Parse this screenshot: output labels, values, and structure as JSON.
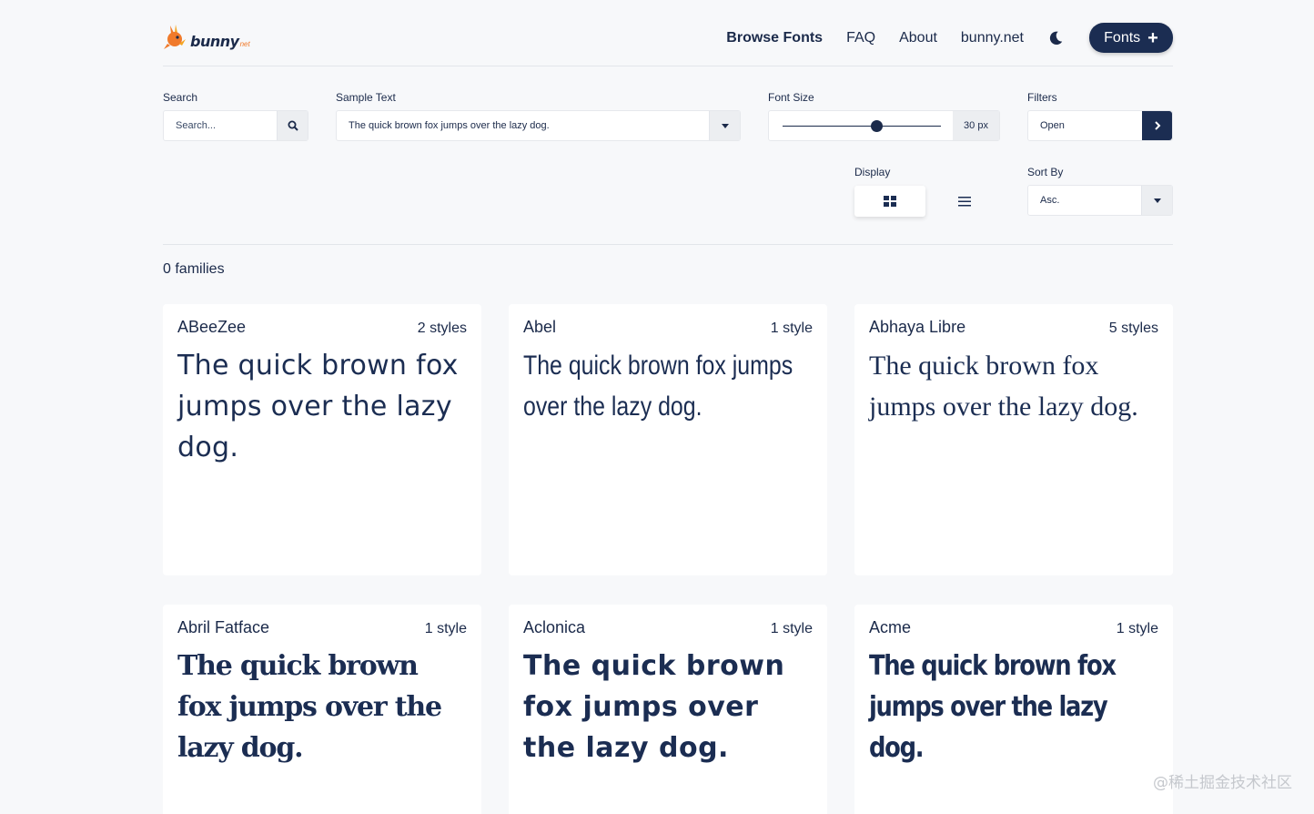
{
  "header": {
    "logo_text": "bunny",
    "logo_suffix": "net",
    "nav": [
      {
        "label": "Browse Fonts",
        "active": true
      },
      {
        "label": "FAQ"
      },
      {
        "label": "About"
      },
      {
        "label": "bunny.net"
      }
    ],
    "theme_icon": "moon-icon",
    "fonts_button": "Fonts",
    "fonts_button_icon": "plus-icon"
  },
  "controls": {
    "search": {
      "label": "Search",
      "placeholder": "Search..."
    },
    "sample_text": {
      "label": "Sample Text",
      "value": "The quick brown fox jumps over the lazy dog."
    },
    "font_size": {
      "label": "Font Size",
      "value": 30,
      "display": "30 px",
      "min": 8,
      "max": 48
    },
    "filters": {
      "label": "Filters",
      "value": "Open"
    },
    "display": {
      "label": "Display",
      "selected": "grid"
    },
    "sort_by": {
      "label": "Sort By",
      "value": "Asc."
    }
  },
  "results": {
    "count_text": "0 families"
  },
  "fonts": [
    {
      "name": "ABeeZee",
      "styles": "2 styles",
      "sample": "The quick brown fox jumps over the lazy dog."
    },
    {
      "name": "Abel",
      "styles": "1 style",
      "sample": "The quick brown fox jumps over the lazy dog."
    },
    {
      "name": "Abhaya Libre",
      "styles": "5 styles",
      "sample": "The quick brown fox jumps over the lazy dog."
    },
    {
      "name": "Abril Fatface",
      "styles": "1 style",
      "sample": "The quick brown fox jumps over the lazy dog."
    },
    {
      "name": "Aclonica",
      "styles": "1 style",
      "sample": "The quick brown fox jumps over the lazy dog."
    },
    {
      "name": "Acme",
      "styles": "1 style",
      "sample": "The quick brown fox jumps over the lazy dog."
    }
  ],
  "watermark": "@稀土掘金技术社区",
  "colors": {
    "brand_navy": "#1b2d52",
    "logo_orange": "#f07a2b",
    "background": "#f7f8fa"
  }
}
